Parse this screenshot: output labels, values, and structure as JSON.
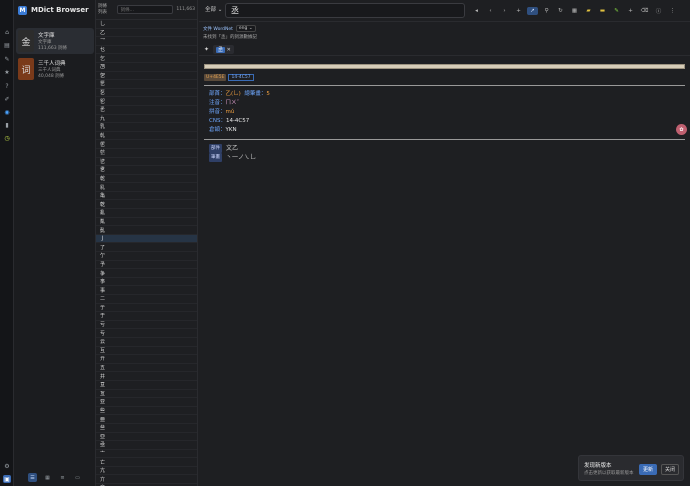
{
  "app": {
    "title": "MDict Browser",
    "logo": "M"
  },
  "rail": {
    "icons": [
      "home-icon",
      "book-icon",
      "pin-icon",
      "star-icon",
      "question-icon",
      "edit-icon",
      "globe-icon",
      "bookmark-icon",
      "clock-icon"
    ],
    "bottom_icons": [
      "gear-icon",
      "tag-icon"
    ]
  },
  "dicts": [
    {
      "name": "文字庫",
      "sub": "文字庫",
      "count": "111,663 詞條",
      "thumb": "金"
    },
    {
      "name": "三千人词典",
      "sub": "三千人词典",
      "count": "40,048 詞條",
      "thumb": "词"
    }
  ],
  "footer_icons": [
    "list-view-icon",
    "grid-view-icon",
    "menu-icon",
    "compact-view-icon"
  ],
  "wordlist": {
    "label_1": "詞條",
    "label_2": "列表",
    "placeholder": "詞條...",
    "count": "111,663",
    "items": [
      "乚",
      "乙",
      "乛",
      "乜",
      "乞",
      "乪",
      "乫",
      "乬",
      "乭",
      "乮",
      "乯",
      "九",
      "乳",
      "乹",
      "乺",
      "乻",
      "乼",
      "乽",
      "乾",
      "乿",
      "亀",
      "亁",
      "亂",
      "亃",
      "亄",
      "亅",
      "了",
      "亇",
      "予",
      "争",
      "亊",
      "事",
      "二",
      "亍",
      "于",
      "亏",
      "亐",
      "云",
      "互",
      "亓",
      "五",
      "井",
      "亘",
      "亙",
      "亚",
      "些",
      "亜",
      "亝",
      "亞",
      "亟",
      "亠",
      "亡",
      "亢",
      "亣",
      "交",
      "亥"
    ],
    "selected_index": 25
  },
  "search": {
    "scope": "全部",
    "query": "丞"
  },
  "tools": [
    "nav-back-icon",
    "nav-first-icon",
    "nav-prev-icon",
    "nav-next-icon",
    "pin-active-icon",
    "zoom-icon",
    "refresh-icon",
    "grid-icon",
    "folder-icon",
    "download-icon",
    "split-icon",
    "plus-icon",
    "clear-icon",
    "info-icon",
    "more-icon"
  ],
  "wordnet": {
    "label": "文件 WordNet",
    "lang": "eng",
    "hint": "未找到「丞」的詞源數據記"
  },
  "tabs": [
    {
      "label": "丞"
    }
  ],
  "entry": {
    "unicode": "U+4E5E",
    "cns": "14-4C57",
    "radical_k": "部首：",
    "radical_v": "乙(乚)",
    "strokes_k": "總筆畫：",
    "strokes_v": "5",
    "zhuyin_k": "注音：",
    "zhuyin_v": "ㄇㄨˇ",
    "pinyin_k": "拼音：",
    "pinyin_v": "mǔ",
    "cns_k": "CNS：",
    "cns_v": "14-4C57",
    "cangjie_k": "倉頡：",
    "cangjie_v": "YKN",
    "comp_tag": "部件",
    "comp_v": "文乙",
    "stroke_tag": "筆畫",
    "stroke_v": "丶一ノ㇏乚"
  },
  "toast": {
    "title": "发现新版本",
    "sub": "点击更新以获取最新版本",
    "update": "更新",
    "close": "关闭"
  }
}
